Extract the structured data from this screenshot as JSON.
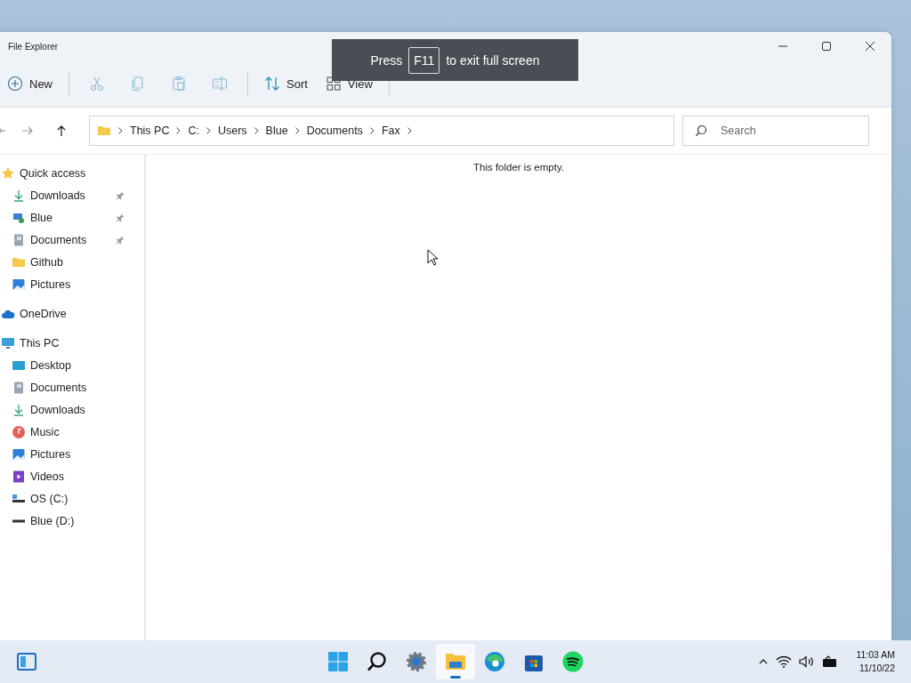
{
  "window": {
    "title": "File Explorer"
  },
  "toolbar": [
    {
      "kind": "new",
      "label": "New"
    },
    {
      "kind": "cut"
    },
    {
      "kind": "copy"
    },
    {
      "kind": "paste"
    },
    {
      "kind": "rename"
    },
    {
      "kind": "sort",
      "label": "Sort"
    },
    {
      "kind": "view",
      "label": "View"
    }
  ],
  "fullscreen_notice": {
    "before": "Press",
    "key": "F11",
    "after": "to exit full screen"
  },
  "address_bar": {
    "segments": [
      "This PC",
      "C:",
      "Users",
      "Blue",
      "Documents",
      "Fax"
    ]
  },
  "search": {
    "placeholder": "Search"
  },
  "sidebar": [
    {
      "label": "Quick access",
      "kind": "star",
      "children": [
        {
          "label": "Downloads",
          "kind": "download",
          "pinned": true
        },
        {
          "label": "Blue",
          "kind": "user",
          "pinned": true
        },
        {
          "label": "Documents",
          "kind": "documents",
          "pinned": true
        },
        {
          "label": "Github",
          "kind": "folder",
          "pinned": false
        },
        {
          "label": "Pictures",
          "kind": "pictures",
          "pinned": false
        }
      ]
    },
    {
      "label": "OneDrive",
      "kind": "cloud"
    },
    {
      "label": "This PC",
      "kind": "pc",
      "children": [
        {
          "label": "Desktop",
          "kind": "desktop"
        },
        {
          "label": "Documents",
          "kind": "documents"
        },
        {
          "label": "Downloads",
          "kind": "download"
        },
        {
          "label": "Music",
          "kind": "music"
        },
        {
          "label": "Pictures",
          "kind": "pictures"
        },
        {
          "label": "Videos",
          "kind": "videos"
        },
        {
          "label": "OS (C:)",
          "kind": "drive-os"
        },
        {
          "label": "Blue (D:)",
          "kind": "drive"
        }
      ]
    }
  ],
  "content": {
    "message": "This folder is empty."
  },
  "taskbar": {
    "apps": [
      {
        "kind": "start",
        "selected": false
      },
      {
        "kind": "search",
        "selected": false
      },
      {
        "kind": "settings",
        "selected": false
      },
      {
        "kind": "explorer",
        "selected": true
      },
      {
        "kind": "browser",
        "selected": false
      },
      {
        "kind": "store",
        "selected": false
      },
      {
        "kind": "music",
        "selected": false
      }
    ],
    "time": "11:03 AM",
    "date": "11/10/22"
  }
}
